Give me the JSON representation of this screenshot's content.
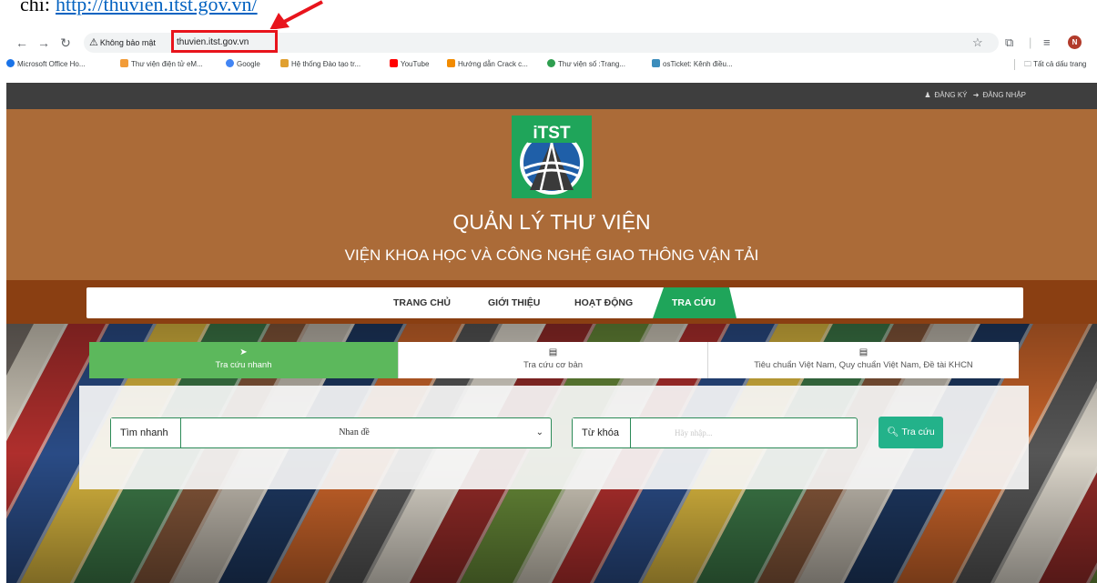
{
  "document": {
    "link_prefix": "chỉ:",
    "link_text": "http://thuvien.itst.gov.vn/"
  },
  "browser": {
    "security_label": "Không bảo mật",
    "url": "thuvien.itst.gov.vn",
    "profile_initial": "N",
    "bookmarks": [
      {
        "label": "Microsoft Office Ho...",
        "color": "#1a73e8"
      },
      {
        "label": "Thư viện điện tử eM...",
        "color": "#f29c38"
      },
      {
        "label": "Google",
        "color": "#4285f4"
      },
      {
        "label": "Hệ thống Đào tạo tr...",
        "color": "#e0a030"
      },
      {
        "label": "YouTube",
        "color": "#ff0000"
      },
      {
        "label": "Hướng dẫn Crack c...",
        "color": "#f28b00"
      },
      {
        "label": "Thư viện số :Trang...",
        "color": "#2e9e4f"
      },
      {
        "label": "osTicket: Kênh điều...",
        "color": "#3c8dbc"
      }
    ],
    "bookmarks_folder": "Tất cả dấu trang"
  },
  "site": {
    "register": "ĐĂNG KÝ",
    "login": "ĐĂNG NHẬP",
    "logo_text": "iTST",
    "title": "QUẢN LÝ THƯ VIỆN",
    "subtitle": "VIỆN KHOA HỌC VÀ CÔNG NGHỆ GIAO THÔNG VẬN TẢI",
    "nav": [
      {
        "label": "TRANG CHỦ"
      },
      {
        "label": "GIỚI THIỆU"
      },
      {
        "label": "HOẠT ĐỘNG"
      },
      {
        "label": "TRA CỨU",
        "active": true
      }
    ],
    "colors": {
      "header": "#ab6b38",
      "navband": "#8a3f12",
      "accent": "#5cb85c",
      "button": "#23b28a"
    }
  },
  "search": {
    "tabs": [
      {
        "label": "Tra cứu nhanh",
        "icon": "paper-plane-icon",
        "active": true
      },
      {
        "label": "Tra cứu cơ bản",
        "icon": "list-icon"
      },
      {
        "label": "Tiêu chuẩn Việt Nam, Quy chuẩn Việt Nam, Đề tài KHCN",
        "icon": "list-icon"
      }
    ],
    "quick_label": "Tìm nhanh",
    "field_selected": "Nhan đề",
    "keyword_label": "Từ khóa",
    "keyword_placeholder": "Hãy nhập...",
    "keyword_value": "",
    "button_label": "Tra cứu"
  }
}
